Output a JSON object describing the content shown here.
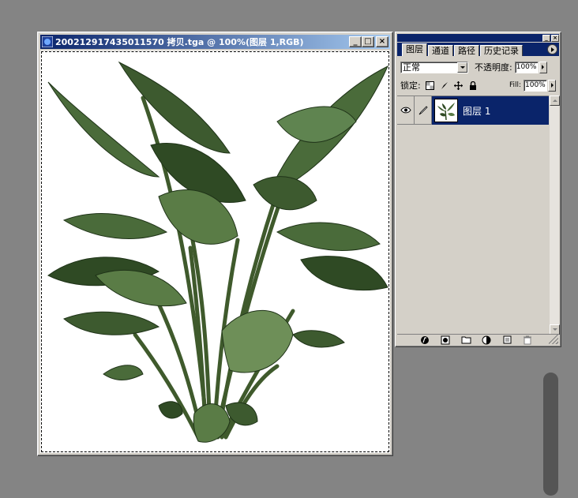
{
  "document": {
    "title": "200212917435011570 拷贝.tga @ 100%(图层 1,RGB)",
    "minimize_glyph": "_",
    "maximize_glyph": "□",
    "close_glyph": "×"
  },
  "layers_palette": {
    "tabs": [
      "图层",
      "通道",
      "路径",
      "历史记录"
    ],
    "blend_mode": "正常",
    "opacity_label": "不透明度:",
    "opacity_value": "100%",
    "lock_label": "锁定:",
    "fill_label": "Fill:",
    "fill_value": "100%",
    "layer": {
      "name": "图层 1"
    }
  },
  "colors": {
    "desktop_bg": "#848484",
    "title_active": "#0a246a",
    "window_face": "#d4d0c8",
    "selection": "#0a246a",
    "leaf_dark": "#2f4a24",
    "leaf_mid": "#4a6b3a",
    "leaf_light": "#7d9b66"
  },
  "icons": [
    "photoshop-app-icon",
    "eye-icon",
    "brush-icon",
    "palette-menu-icon",
    "lock-transparency-icon",
    "lock-paint-icon",
    "lock-move-icon",
    "lock-all-icon",
    "layer-style-icon",
    "layer-mask-icon",
    "new-set-icon",
    "adjustment-layer-icon",
    "new-layer-icon",
    "trash-icon"
  ]
}
